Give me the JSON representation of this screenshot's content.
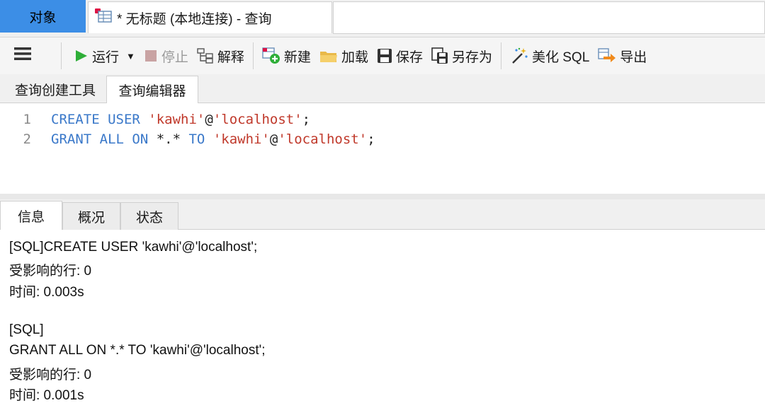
{
  "tabs": {
    "objects_label": "对象",
    "query_label": "* 无标题 (本地连接) - 查询"
  },
  "toolbar": {
    "run": "运行",
    "stop": "停止",
    "explain": "解释",
    "new": "新建",
    "load": "加载",
    "save": "保存",
    "save_as": "另存为",
    "beautify": "美化 SQL",
    "export": "导出"
  },
  "subtabs": {
    "builder": "查询创建工具",
    "editor": "查询编辑器"
  },
  "editor": {
    "lines": [
      {
        "num": "1",
        "kw1": "CREATE USER",
        "s1": "'kawhi'",
        "p1": "@",
        "s2": "'localhost'",
        "p2": ";"
      },
      {
        "num": "2",
        "kw1": "GRANT ALL ON",
        "p0": " *.* ",
        "kw2": "TO",
        "s1": "'kawhi'",
        "p1": "@",
        "s2": "'localhost'",
        "p2": ";"
      }
    ]
  },
  "result_tabs": {
    "info": "信息",
    "overview": "概况",
    "status": "状态"
  },
  "messages": {
    "m1": "[SQL]CREATE USER 'kawhi'@'localhost';",
    "m2": "受影响的行: 0",
    "m3": "时间: 0.003s",
    "m4": "[SQL]",
    "m5": "GRANT ALL ON *.* TO 'kawhi'@'localhost';",
    "m6": "受影响的行: 0",
    "m7": "时间: 0.001s"
  },
  "colors": {
    "accent": "#3c8ee6",
    "keyword": "#3a78c9",
    "string": "#c0392b",
    "run_green": "#2eae38"
  }
}
